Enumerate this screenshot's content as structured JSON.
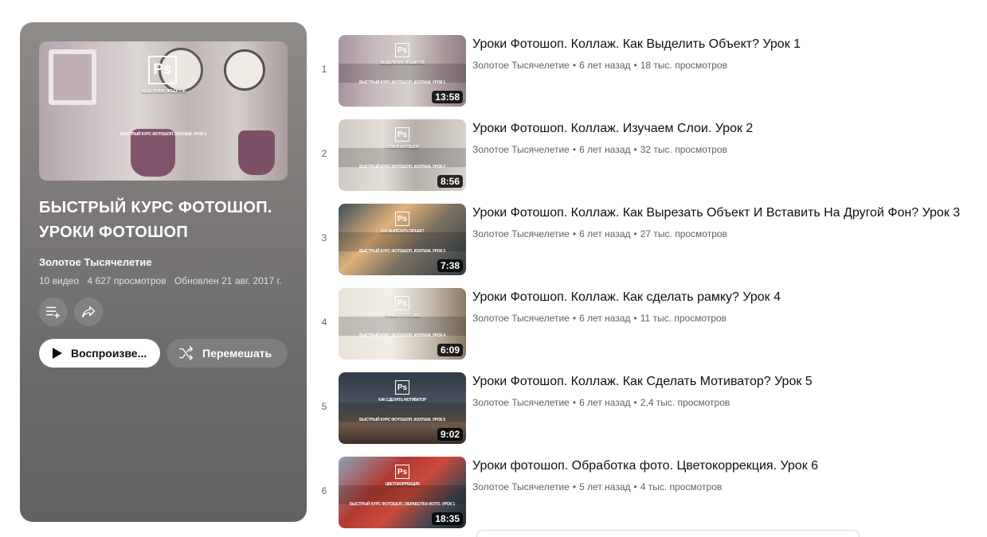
{
  "playlist": {
    "title_line1": "БЫСТРЫЙ КУРС ФОТОШОП.",
    "title_line2": "УРОКИ ФОТОШОП",
    "channel": "Золотое Тысячелетие",
    "video_count": "10 видео",
    "views": "4 627 просмотров",
    "updated": "Обновлен 21 авг. 2017 г.",
    "cover": {
      "big_text": "ВЫДЕЛЕНИЕ ОБЪЕКТОВ",
      "small_text": "БЫСТРЫЙ КУРС ФОТОШОП. КОЛЛАЖ. УРОК 1",
      "logo": "Ps"
    },
    "buttons": {
      "add_icon": "playlist-add-icon",
      "share_icon": "share-icon",
      "play_label": "Воспроизве...",
      "shuffle_label": "Перемешать"
    }
  },
  "videos": [
    {
      "index": "1",
      "title": "Уроки Фотошоп. Коллаж. Как Выделить Объект? Урок 1",
      "channel": "Золотое Тысячелетие",
      "age": "6 лет назад",
      "views": "18 тыс. просмотров",
      "duration": "13:58",
      "thumb_big": "ВЫДЕЛЕНИЕ ОБЪЕКТОВ",
      "thumb_small": "БЫСТРЫЙ КУРС ФОТОШОП. КОЛЛАЖ. УРОК 1",
      "logo": "Ps"
    },
    {
      "index": "2",
      "title": "Уроки Фотошоп. Коллаж. Изучаем Слои. Урок 2",
      "channel": "Золотое Тысячелетие",
      "age": "6 лет назад",
      "views": "32 тыс. просмотров",
      "duration": "8:56",
      "thumb_big": "СЛОИ В ФОТОШОП",
      "thumb_small": "БЫСТРЫЙ КУРС ФОТОШОП. КОЛЛАЖ. УРОК 2",
      "logo": "Ps"
    },
    {
      "index": "3",
      "title": "Уроки Фотошоп. Коллаж. Как Вырезать Объект И Вставить На Другой Фон? Урок 3",
      "channel": "Золотое Тысячелетие",
      "age": "6 лет назад",
      "views": "27 тыс. просмотров",
      "duration": "7:38",
      "thumb_big": "КАК ВЫРЕЗАТЬ ОБЪЕКТ",
      "thumb_small": "БЫСТРЫЙ КУРС ФОТОШОП. КОЛЛАЖ. УРОК 3",
      "logo": "Ps"
    },
    {
      "index": "4",
      "title": "Уроки Фотошоп. Коллаж. Как сделать рамку? Урок 4",
      "channel": "Золотое Тысячелетие",
      "age": "6 лет назад",
      "views": "11 тыс. просмотров",
      "duration": "6:09",
      "thumb_big": "РАМКА. 2 СПОСОБА",
      "thumb_small": "БЫСТРЫЙ КУРС ФОТОШОП. КОЛЛАЖ. УРОК 4",
      "logo": "Ps"
    },
    {
      "index": "5",
      "title": "Уроки Фотошоп. Коллаж. Как Сделать Мотиватор? Урок 5",
      "channel": "Золотое Тысячелетие",
      "age": "6 лет назад",
      "views": "2,4 тыс. просмотров",
      "duration": "9:02",
      "thumb_big": "КАК СДЕЛАТЬ МОТИВАТОР",
      "thumb_small": "БЫСТРЫЙ КУРС ФОТОШОП. КОЛЛАЖ. УРОК 5",
      "logo": "Ps"
    },
    {
      "index": "6",
      "title": "Уроки фотошоп. Обработка фото. Цветокоррекция. Урок 6",
      "channel": "Золотое Тысячелетие",
      "age": "5 лет назад",
      "views": "4 тыс. просмотров",
      "duration": "18:35",
      "thumb_big": "ЦВЕТОКОРРЕКЦИЯ",
      "thumb_small": "БЫСТРЫЙ КУРС ФОТОШОП. ОБРАБОТКА ФОТО. УРОК 1",
      "logo": "Ps"
    }
  ],
  "colors": {
    "panel_bg": "#7a7776",
    "text_primary": "#0f0f0f",
    "text_secondary": "#606060"
  }
}
